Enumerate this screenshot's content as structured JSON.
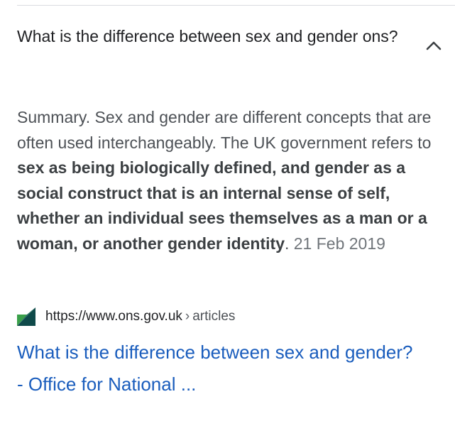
{
  "faq": {
    "question": "What is the difference between sex and gender ons?",
    "expand_icon": "chevron-up-icon"
  },
  "answer": {
    "intro": "Summary. Sex and gender are different concepts that are often used interchangeably. The UK government refers to ",
    "bold": "sex as being biologically defined, and gender as a social construct that is an internal sense of self, whether an individual sees themselves as a man or a woman, or another gender identity",
    "after_bold": ". ",
    "date": "21 Feb 2019"
  },
  "source": {
    "favicon": "ons-logo-icon",
    "url": "https://www.ons.gov.uk",
    "separator": "›",
    "path": "articles"
  },
  "result": {
    "title": "What is the difference between sex and gender? - Office for National ..."
  },
  "colors": {
    "link": "#1a5dbd",
    "text": "#202124",
    "favicon_dark": "#0f4a4a",
    "favicon_green": "#3aa04a"
  }
}
